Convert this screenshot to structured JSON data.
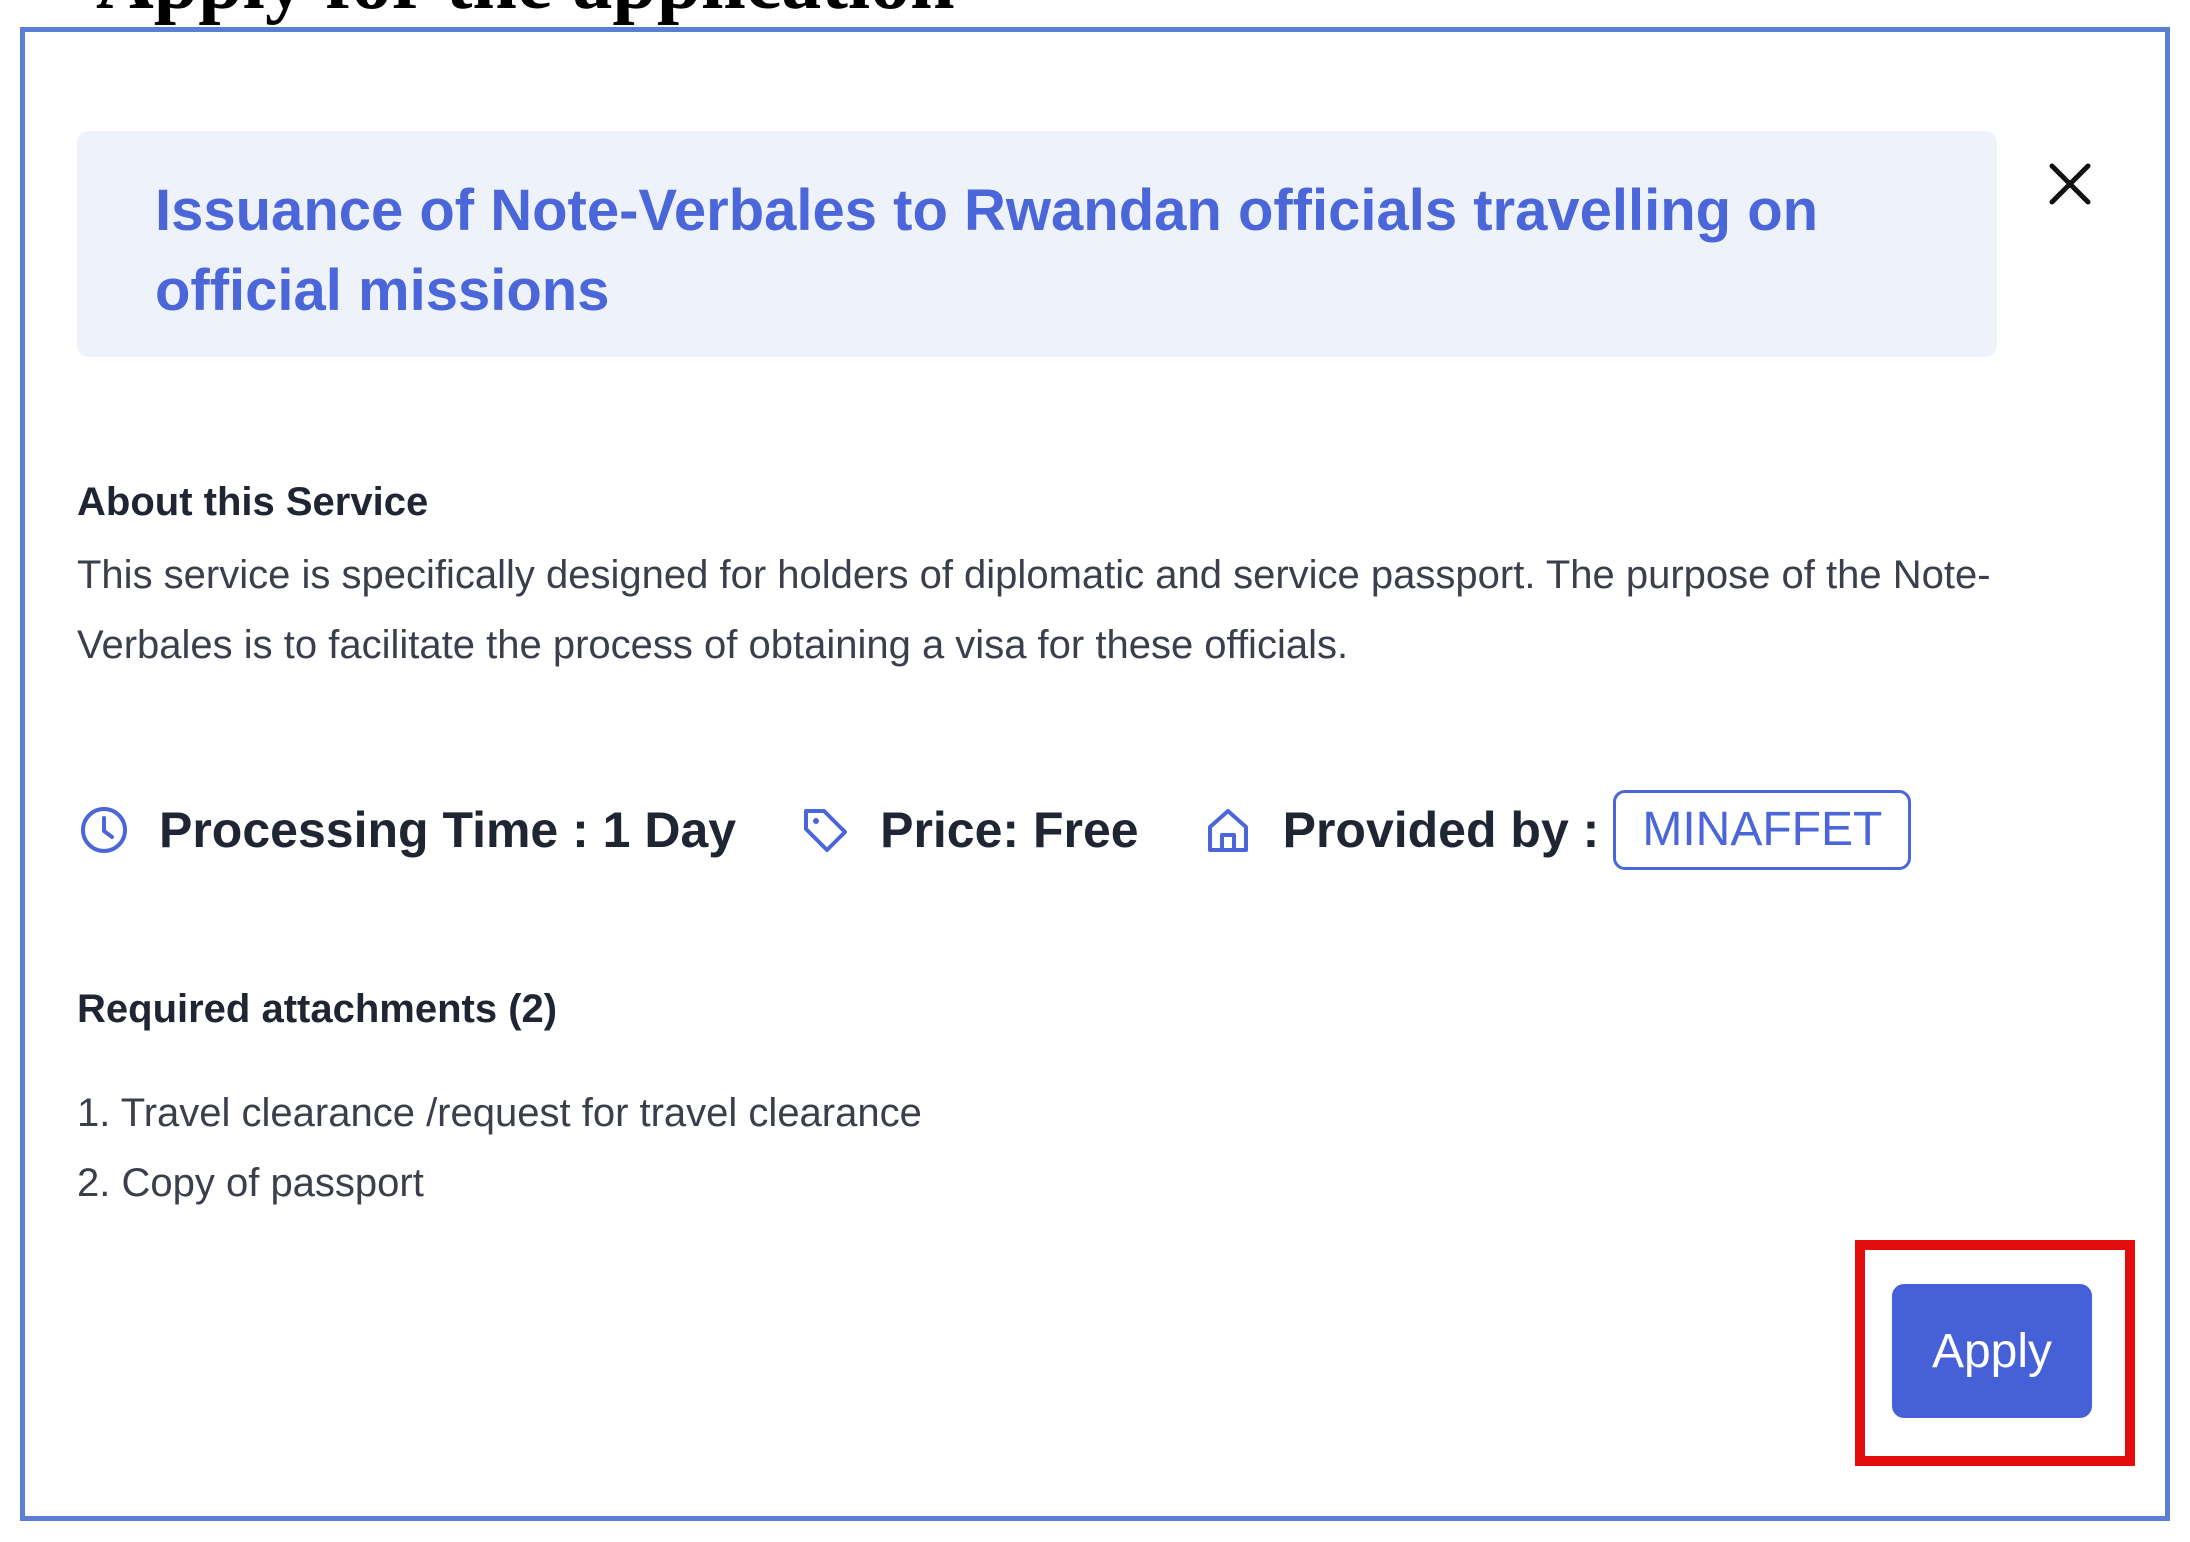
{
  "caption": {
    "text": "Apply for the application"
  },
  "modal": {
    "title": "Issuance of Note-Verbales to Rwandan officials travelling on official missions",
    "close_icon": "close-icon"
  },
  "about": {
    "label": "About this Service",
    "text": "This service is specifically designed for holders of diplomatic and service passport. The purpose of the Note-Verbales is to facilitate the process of obtaining a visa for these officials."
  },
  "meta": {
    "processing_time": "Processing Time : 1 Day",
    "price": "Price: Free",
    "provided_by_label": "Provided by :",
    "provider": "MINAFFET",
    "icons": [
      "clock-icon",
      "tag-icon",
      "home-icon"
    ]
  },
  "attachments": {
    "label": "Required attachments (2)",
    "items": [
      "1. Travel clearance /request for travel clearance",
      "2. Copy of passport"
    ]
  },
  "actions": {
    "apply_label": "Apply"
  },
  "colors": {
    "accent": "#4a66d8",
    "title_bg": "#eef2fb",
    "modal_border": "#5b7fd6",
    "highlight": "#e30d0d",
    "button_bg": "#4660d8"
  }
}
